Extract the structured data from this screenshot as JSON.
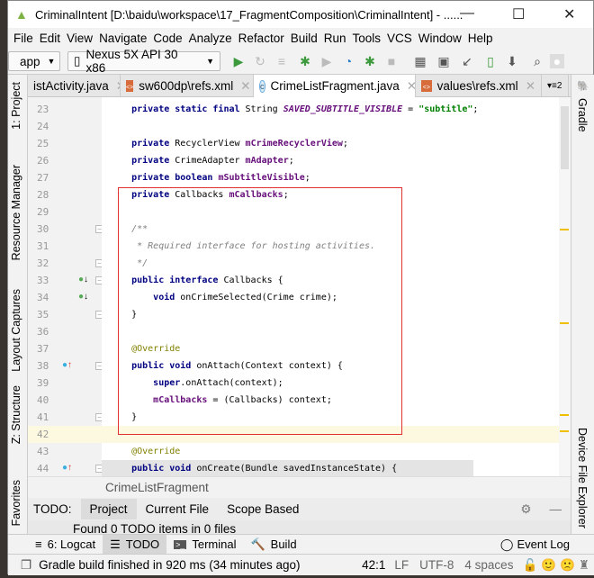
{
  "window": {
    "title": "CriminalIntent [D:\\baidu\\workspace\\17_FragmentComposition\\CriminalIntent] - ......",
    "minimize": "—",
    "maximize": "☐",
    "close": "✕"
  },
  "menu": [
    "File",
    "Edit",
    "View",
    "Navigate",
    "Code",
    "Analyze",
    "Refactor",
    "Build",
    "Run",
    "Tools",
    "VCS",
    "Window",
    "Help"
  ],
  "toolbar": {
    "module": "app",
    "device": "Nexus 5X API 30 x86"
  },
  "tabs": [
    {
      "label": "istActivity.java",
      "type": "java"
    },
    {
      "label": "sw600dp\\refs.xml",
      "type": "xml"
    },
    {
      "label": "CrimeListFragment.java",
      "type": "class",
      "active": true
    },
    {
      "label": "values\\refs.xml",
      "type": "xml"
    }
  ],
  "tab_overflow": "2",
  "left_tools": [
    "1: Project",
    "Resource Manager",
    "Layout Captures",
    "Z: Structure",
    "Favorites"
  ],
  "right_tools": [
    "Gradle",
    "Device File Explorer"
  ],
  "editor": {
    "lines": [
      {
        "n": 23,
        "tokens": [
          {
            "t": "    "
          },
          {
            "t": "private static final",
            "c": "kw"
          },
          {
            "t": " String "
          },
          {
            "t": "SAVED_SUBTITLE_VISIBLE",
            "c": "const"
          },
          {
            "t": " = "
          },
          {
            "t": "\"subtitle\"",
            "c": "str"
          },
          {
            "t": ";"
          }
        ]
      },
      {
        "n": 24,
        "tokens": []
      },
      {
        "n": 25,
        "tokens": [
          {
            "t": "    "
          },
          {
            "t": "private",
            "c": "kw"
          },
          {
            "t": " RecyclerView "
          },
          {
            "t": "mCrimeRecyclerView",
            "c": "fld"
          },
          {
            "t": ";"
          }
        ]
      },
      {
        "n": 26,
        "tokens": [
          {
            "t": "    "
          },
          {
            "t": "private",
            "c": "kw"
          },
          {
            "t": " CrimeAdapter "
          },
          {
            "t": "mAdapter",
            "c": "fld"
          },
          {
            "t": ";"
          }
        ]
      },
      {
        "n": 27,
        "tokens": [
          {
            "t": "    "
          },
          {
            "t": "private boolean",
            "c": "kw"
          },
          {
            "t": " "
          },
          {
            "t": "mSubtitleVisible",
            "c": "fld"
          },
          {
            "t": ";"
          }
        ]
      },
      {
        "n": 28,
        "tokens": [
          {
            "t": "    "
          },
          {
            "t": "private",
            "c": "kw"
          },
          {
            "t": " Callbacks "
          },
          {
            "t": "mCallbacks",
            "c": "fld"
          },
          {
            "t": ";"
          }
        ]
      },
      {
        "n": 29,
        "tokens": []
      },
      {
        "n": 30,
        "tokens": [
          {
            "t": "    "
          },
          {
            "t": "/**",
            "c": "cmt"
          }
        ]
      },
      {
        "n": 31,
        "tokens": [
          {
            "t": "     "
          },
          {
            "t": "* Required interface for hosting activities.",
            "c": "cmt"
          }
        ]
      },
      {
        "n": 32,
        "tokens": [
          {
            "t": "     "
          },
          {
            "t": "*/",
            "c": "cmt"
          }
        ]
      },
      {
        "n": 33,
        "tokens": [
          {
            "t": "    "
          },
          {
            "t": "public interface",
            "c": "kw"
          },
          {
            "t": " Callbacks {"
          }
        ]
      },
      {
        "n": 34,
        "tokens": [
          {
            "t": "        "
          },
          {
            "t": "void",
            "c": "kw"
          },
          {
            "t": " onCrimeSelected(Crime crime);"
          }
        ]
      },
      {
        "n": 35,
        "tokens": [
          {
            "t": "    }"
          }
        ]
      },
      {
        "n": 36,
        "tokens": []
      },
      {
        "n": 37,
        "tokens": [
          {
            "t": "    "
          },
          {
            "t": "@Override",
            "c": "ann"
          }
        ]
      },
      {
        "n": 38,
        "tokens": [
          {
            "t": "    "
          },
          {
            "t": "public void",
            "c": "kw"
          },
          {
            "t": " onAttach(Context context) {"
          }
        ]
      },
      {
        "n": 39,
        "tokens": [
          {
            "t": "        "
          },
          {
            "t": "super",
            "c": "kw"
          },
          {
            "t": ".onAttach(context);"
          }
        ]
      },
      {
        "n": 40,
        "tokens": [
          {
            "t": "        "
          },
          {
            "t": "mCallbacks",
            "c": "fld"
          },
          {
            "t": " = (Callbacks) context;"
          }
        ]
      },
      {
        "n": 41,
        "tokens": [
          {
            "t": "    }"
          }
        ]
      },
      {
        "n": 42,
        "tokens": []
      },
      {
        "n": 43,
        "tokens": [
          {
            "t": "    "
          },
          {
            "t": "@Override",
            "c": "ann"
          }
        ]
      },
      {
        "n": 44,
        "tokens": [
          {
            "t": "    "
          },
          {
            "t": "public void",
            "c": "kw"
          },
          {
            "t": " onCreate(Bundle savedInstanceState) {"
          }
        ]
      }
    ]
  },
  "breadcrumb": "CrimeListFragment",
  "todo": {
    "label": "TODO:",
    "tabs": [
      "Project",
      "Current File",
      "Scope Based"
    ],
    "selected": "Project",
    "message": "Found 0 TODO items in 0 files"
  },
  "bottom_tools": [
    "6: Logcat",
    "TODO",
    "Terminal",
    "Build"
  ],
  "event_log": "Event Log",
  "status": {
    "message": "Gradle build finished in 920 ms (34 minutes ago)",
    "position": "42:1",
    "line_sep": "LF",
    "encoding": "UTF-8",
    "indent": "4 spaces"
  },
  "colors": {
    "keyword": "#000080",
    "field": "#660e7a",
    "string": "#008000",
    "comment": "#808080",
    "annotation": "#808000",
    "highlight_box": "#e03030",
    "run": "#3c9a3c"
  }
}
